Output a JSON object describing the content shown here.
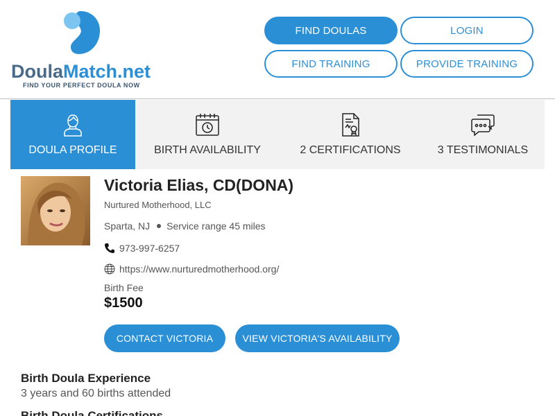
{
  "brand": {
    "name_part1": "Doula",
    "name_part2": "Match.net",
    "tagline": "FIND YOUR PERFECT DOULA NOW",
    "primary_color": "#2b8fd6",
    "logo_icon": "logo-mark-icon"
  },
  "header_nav": {
    "find_doulas": "FIND DOULAS",
    "login": "LOGIN",
    "find_training": "FIND TRAINING",
    "provide_training": "PROVIDE TRAINING"
  },
  "tabs": [
    {
      "label": "DOULA PROFILE",
      "icon": "person-icon",
      "active": true
    },
    {
      "label": "BIRTH AVAILABILITY",
      "icon": "calendar-clock-icon",
      "active": false
    },
    {
      "label": "2 CERTIFICATIONS",
      "icon": "certificate-icon",
      "active": false
    },
    {
      "label": "3 TESTIMONIALS",
      "icon": "chat-bubbles-icon",
      "active": false
    }
  ],
  "profile": {
    "name": "Victoria Elias, CD(DONA)",
    "organization": "Nurtured Motherhood, LLC",
    "location": "Sparta, NJ",
    "service_range": "Service range 45 miles",
    "phone": "973-997-6257",
    "website": "https://www.nurturedmotherhood.org/",
    "fee_label": "Birth Fee",
    "fee_value": "$1500",
    "contact_button": "CONTACT VICTORIA",
    "availability_button": "VIEW VICTORIA'S AVAILABILITY"
  },
  "sections": {
    "experience_title": "Birth Doula Experience",
    "experience_text": "3 years and 60 births attended",
    "certifications_title": "Birth Doula Certifications"
  }
}
